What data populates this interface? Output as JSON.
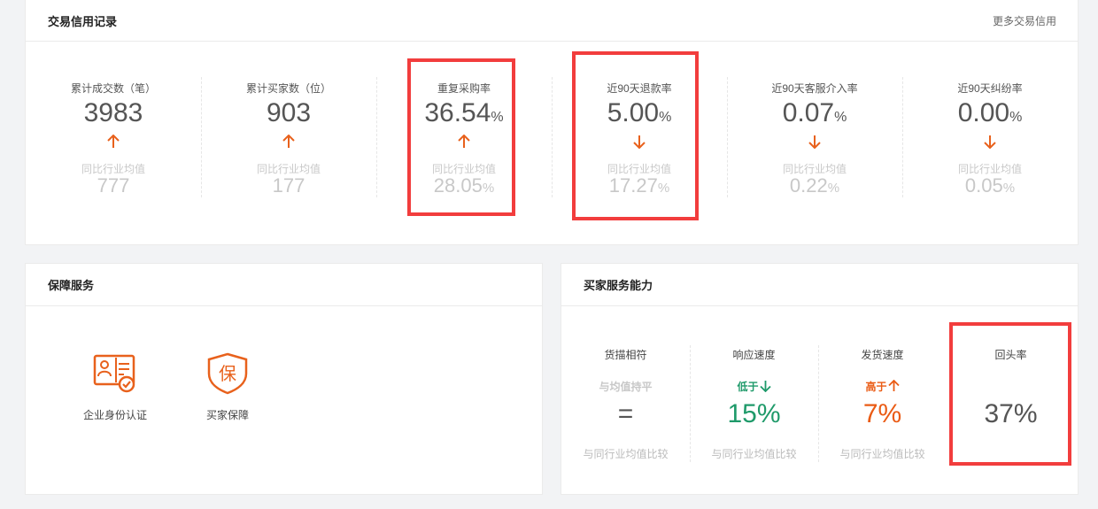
{
  "credit": {
    "title": "交易信用记录",
    "more_link": "更多交易信用",
    "compare_label": "同比行业均值",
    "metrics": [
      {
        "label": "累计成交数（笔）",
        "value": "3983",
        "unit": "",
        "trend": "up",
        "avg": "777",
        "avg_unit": ""
      },
      {
        "label": "累计买家数（位）",
        "value": "903",
        "unit": "",
        "trend": "up",
        "avg": "177",
        "avg_unit": ""
      },
      {
        "label": "重复采购率",
        "value": "36.54",
        "unit": "%",
        "trend": "up",
        "avg": "28.05",
        "avg_unit": "%"
      },
      {
        "label": "近90天退款率",
        "value": "5.00",
        "unit": "%",
        "trend": "down",
        "avg": "17.27",
        "avg_unit": "%"
      },
      {
        "label": "近90天客服介入率",
        "value": "0.07",
        "unit": "%",
        "trend": "down",
        "avg": "0.22",
        "avg_unit": "%"
      },
      {
        "label": "近90天纠纷率",
        "value": "0.00",
        "unit": "%",
        "trend": "down",
        "avg": "0.05",
        "avg_unit": "%"
      }
    ]
  },
  "guarantee": {
    "title": "保障服务",
    "items": [
      {
        "label": "企业身份认证",
        "icon": "id-card-check-icon"
      },
      {
        "label": "买家保障",
        "icon": "shield-bao-icon",
        "glyph": "保"
      }
    ]
  },
  "buyer_service": {
    "title": "买家服务能力",
    "compare_label": "与同行业均值比较",
    "columns": [
      {
        "label": "货描相符",
        "tag": "与均值持平",
        "big": "=",
        "foot": "与同行业均值比较"
      },
      {
        "label": "响应速度",
        "tag": "低于",
        "big": "15%",
        "foot": "与同行业均值比较"
      },
      {
        "label": "发货速度",
        "tag": "高于",
        "big": "7%",
        "foot": "与同行业均值比较"
      },
      {
        "label": "回头率",
        "tag": "",
        "big": "37%",
        "foot": ""
      }
    ]
  },
  "colors": {
    "accent_orange": "#e8611c",
    "down_green": "#1f9a6a",
    "up_orange": "#ea5b14",
    "highlight_red": "#f23d3d",
    "muted": "#c8c8c8"
  }
}
